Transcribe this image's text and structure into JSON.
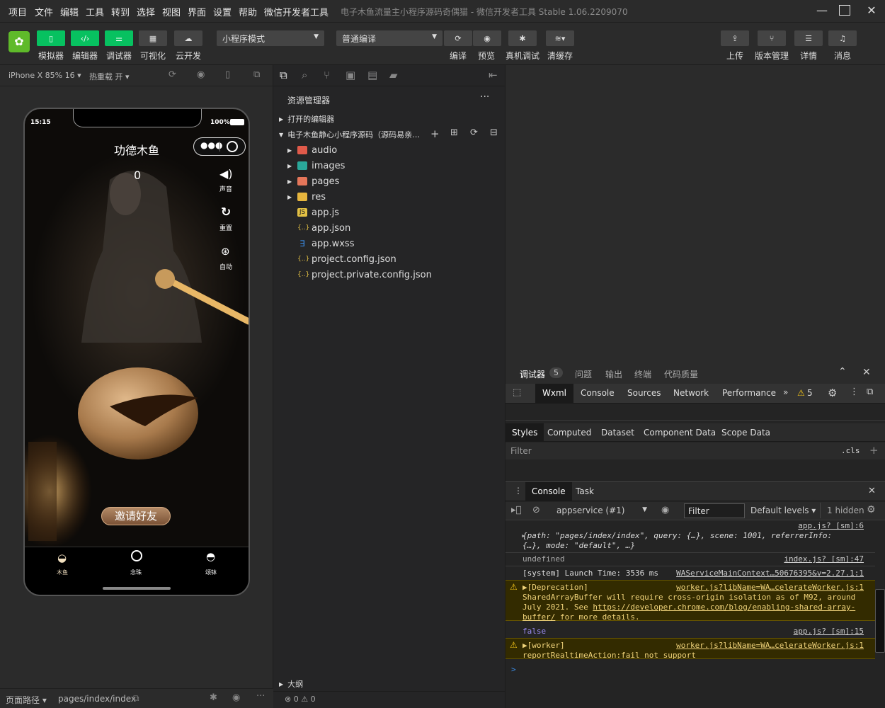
{
  "menu": [
    "项目",
    "文件",
    "编辑",
    "工具",
    "转到",
    "选择",
    "视图",
    "界面",
    "设置",
    "帮助",
    "微信开发者工具"
  ],
  "window_title": "电子木鱼流量主小程序源码奇偶猫 - 微信开发者工具 Stable 1.06.2209070",
  "toolbar": {
    "simulator": "模拟器",
    "editor": "编辑器",
    "debugger": "调试器",
    "visual": "可视化",
    "cloud": "云开发",
    "mode": "小程序模式",
    "compile_mode": "普通编译",
    "compile": "编译",
    "preview": "预览",
    "remote_debug": "真机调试",
    "clear_cache": "清缓存",
    "upload": "上传",
    "version": "版本管理",
    "details": "详情",
    "messages": "消息"
  },
  "sim": {
    "device": "iPhone X 85% 16",
    "hot_reload": "热重载 开"
  },
  "phone": {
    "time": "15:15",
    "battery": "100%",
    "title": "功德木鱼",
    "count": "0",
    "sound": "声音",
    "reset": "重置",
    "auto": "自动",
    "invite": "邀请好友",
    "tabs": [
      "木鱼",
      "念珠",
      "颂钵"
    ]
  },
  "explorer": {
    "header": "资源管理器",
    "open_editors": "打开的编辑器",
    "project": "电子木鱼静心小程序源码（源码易亲…",
    "folders": [
      "audio",
      "images",
      "pages",
      "res"
    ],
    "files": [
      "app.js",
      "app.json",
      "app.wxss",
      "project.config.json",
      "project.private.config.json"
    ],
    "outline": "大纲",
    "status_errors": "0",
    "status_warnings": "0"
  },
  "status": {
    "path_label": "页面路径",
    "path": "pages/index/index"
  },
  "devtools": {
    "top_tabs": [
      "调试器",
      "问题",
      "输出",
      "终端",
      "代码质量"
    ],
    "badge": "5",
    "panel_tabs": [
      "Wxml",
      "Console",
      "Sources",
      "Network",
      "Performance"
    ],
    "warn_count": "5",
    "style_tabs": [
      "Styles",
      "Computed",
      "Dataset",
      "Component Data",
      "Scope Data"
    ],
    "filter": "Filter",
    "cls": ".cls",
    "drawer_tabs": [
      "Console",
      "Task"
    ],
    "context": "appservice (#1)",
    "console_filter": "Filter",
    "levels": "Default levels",
    "hidden": "1 hidden",
    "logs": {
      "l1_src": "app.js? [sm]:6",
      "l1a": "{path: \"pages/index/index\", query: {…}, scene: 1001, referrerInfo:",
      "l1b": "{…}, mode: \"default\", …}",
      "l2": "undefined",
      "l2_src": "index.js? [sm]:47",
      "l3": "[system] Launch Time: 3536 ms",
      "l3_src": "WAServiceMainContext…50676395&v=2.27.1:1",
      "w1": "▶[Deprecation]",
      "w1_src": "worker.js?libName=WA…celerateWorker.js:1",
      "w1b": "SharedArrayBuffer will require cross-origin isolation as of M92, around",
      "w1c": "July 2021. See ",
      "w1c_link": "https://developer.chrome.com/blog/enabling-shared-array-",
      "w1d": "buffer/",
      "w1d_tail": " for more details.",
      "l4": "false",
      "l4_src": "app.js? [sm]:15",
      "w2": "▶[worker]",
      "w2_src": "worker.js?libName=WA…celerateWorker.js:1",
      "w2b": "reportRealtimeAction:fail not support"
    }
  },
  "colors": {
    "accent": "#07c160",
    "warn": "#f5c518"
  }
}
